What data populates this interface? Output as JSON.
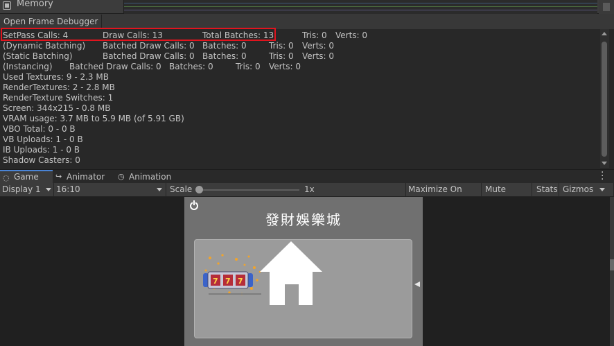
{
  "memory": {
    "title": "Memory"
  },
  "frame_debugger": {
    "button_label": "Open Frame Debugger"
  },
  "stats": {
    "lines": [
      {
        "cols": [
          "SetPass Calls: 4",
          "Draw Calls: 13",
          "Total Batches: 13",
          "Tris: 0",
          "Verts: 0"
        ]
      },
      {
        "cols": [
          "(Dynamic Batching)",
          "Batched Draw Calls: 0",
          "Batches: 0",
          "Tris: 0",
          "Verts: 0"
        ]
      },
      {
        "cols": [
          "(Static Batching)",
          "Batched Draw Calls: 0",
          "Batches: 0",
          "Tris: 0",
          "Verts: 0"
        ]
      },
      {
        "cols": [
          "(Instancing)",
          "Batched Draw Calls: 0",
          "Batches: 0",
          "Tris: 0",
          "Verts: 0"
        ]
      },
      {
        "text": "Used Textures: 9 - 2.3 MB"
      },
      {
        "text": "RenderTextures: 2 - 2.8 MB"
      },
      {
        "text": "RenderTexture Switches: 1"
      },
      {
        "text": "Screen: 344x215 - 0.8 MB"
      },
      {
        "text": "VRAM usage: 3.7 MB to 5.9 MB (of 5.91 GB)"
      },
      {
        "text": "VBO Total: 0 - 0 B"
      },
      {
        "text": "VB Uploads: 1 - 0 B"
      },
      {
        "text": "IB Uploads: 1 - 0 B"
      },
      {
        "text": "Shadow Casters: 0"
      }
    ]
  },
  "tabs": [
    {
      "label": "Game",
      "icon": "gamepad-icon",
      "active": true
    },
    {
      "label": "Animator",
      "icon": "animator-icon",
      "active": false
    },
    {
      "label": "Animation",
      "icon": "clock-icon",
      "active": false
    }
  ],
  "toolbar": {
    "display": "Display 1",
    "aspect": "16:10",
    "scale_label": "Scale",
    "scale_value": "1x",
    "maximize": "Maximize On Play",
    "mute": "Mute Audio",
    "stats": "Stats",
    "gizmos": "Gizmos"
  },
  "game": {
    "title": "發財娛樂城",
    "icons": [
      "power-icon",
      "slot-machine-icon",
      "house-icon"
    ]
  },
  "colors": {
    "highlight": "#e1141e",
    "active_tab": "#4a84d6",
    "game_bg": "#707070",
    "panel_bg": "#9b9b9b"
  }
}
